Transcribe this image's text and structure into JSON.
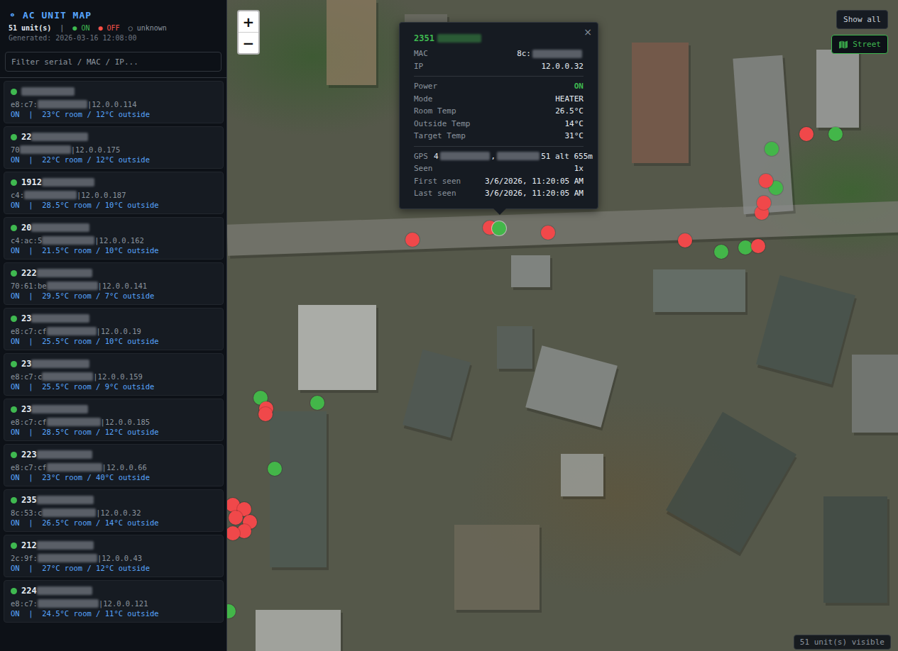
{
  "header": {
    "icon": "⚬",
    "title": "AC UNIT MAP",
    "count": "51 unit(s)",
    "separator": "|",
    "legend": [
      {
        "glyph": "●",
        "label": "ON",
        "color": "#3fb950"
      },
      {
        "glyph": "●",
        "label": "OFF",
        "color": "#f85149"
      },
      {
        "glyph": "○",
        "label": "unknown",
        "color": "#8b949e"
      }
    ],
    "generated": "Generated: 2026-03-16 12:08:00"
  },
  "search": {
    "placeholder": "Filter serial / MAC / IP..."
  },
  "units": [
    {
      "serial": "",
      "mac": "e8:c7:",
      "ip": "12.0.0.114",
      "summary": "ON  |  23°C room / 12°C outside",
      "on": true,
      "color": "#3fb950"
    },
    {
      "serial": "22",
      "mac": "70",
      "ip": "12.0.0.175",
      "summary": "ON  |  22°C room / 12°C outside",
      "on": true,
      "color": "#3fb950"
    },
    {
      "serial": "1912",
      "mac": "c4:",
      "ip": "12.0.0.187",
      "summary": "ON  |  28.5°C room / 10°C outside",
      "on": true,
      "color": "#3fb950"
    },
    {
      "serial": "20",
      "mac": "c4:ac:5",
      "ip": "12.0.0.162",
      "summary": "ON  |  21.5°C room / 10°C outside",
      "on": true,
      "color": "#3fb950"
    },
    {
      "serial": "222",
      "mac": "70:61:be",
      "ip": "12.0.0.141",
      "summary": "ON  |  29.5°C room / 7°C outside",
      "on": true,
      "color": "#3fb950"
    },
    {
      "serial": "23",
      "mac": "e8:c7:cf",
      "ip": "12.0.0.19",
      "summary": "ON  |  25.5°C room / 10°C outside",
      "on": true,
      "color": "#3fb950"
    },
    {
      "serial": "23",
      "mac": "e8:c7:c",
      "ip": "12.0.0.159",
      "summary": "ON  |  25.5°C room / 9°C outside",
      "on": true,
      "color": "#3fb950"
    },
    {
      "serial": "23",
      "mac": "e8:c7:cf",
      "ip": "12.0.0.185",
      "summary": "ON  |  28.5°C room / 12°C outside",
      "on": true,
      "color": "#3fb950"
    },
    {
      "serial": "223",
      "mac": "e8:c7:cf",
      "ip": "12.0.0.66",
      "summary": "ON  |  23°C room / 40°C outside",
      "on": true,
      "color": "#3fb950"
    },
    {
      "serial": "235",
      "mac": "8c:53:c",
      "ip": "12.0.0.32",
      "summary": "ON  |  26.5°C room / 14°C outside",
      "on": true,
      "color": "#3fb950"
    },
    {
      "serial": "212",
      "mac": "2c:9f:",
      "ip": "12.0.0.43",
      "summary": "ON  |  27°C room / 12°C outside",
      "on": true,
      "color": "#3fb950"
    },
    {
      "serial": "224",
      "mac": "e8:c7:",
      "ip": "12.0.0.121",
      "summary": "ON  |  24.5°C room / 11°C outside",
      "on": true,
      "color": "#3fb950"
    }
  ],
  "map": {
    "zoom_in": "+",
    "zoom_out": "−",
    "show_all": "Show all",
    "layer": "Street",
    "visible_count": "51 unit(s) visible",
    "pins": [
      {
        "on": false,
        "color": "#f0484a",
        "selected": false
      },
      {
        "on": false,
        "color": "#f0484a",
        "selected": false
      },
      {
        "on": true,
        "color": "#43b649",
        "selected": true
      },
      {
        "on": false,
        "color": "#f0484a",
        "selected": false
      },
      {
        "on": false,
        "color": "#f0484a",
        "selected": false
      },
      {
        "on": true,
        "color": "#43b649",
        "selected": false
      },
      {
        "on": true,
        "color": "#43b649",
        "selected": false
      },
      {
        "on": false,
        "color": "#f0484a",
        "selected": false
      },
      {
        "on": false,
        "color": "#f0484a",
        "selected": false
      },
      {
        "on": false,
        "color": "#f0484a",
        "selected": false
      },
      {
        "on": true,
        "color": "#43b649",
        "selected": false
      },
      {
        "on": false,
        "color": "#f0484a",
        "selected": false
      },
      {
        "on": true,
        "color": "#43b649",
        "selected": false
      },
      {
        "on": false,
        "color": "#f0484a",
        "selected": false
      },
      {
        "on": true,
        "color": "#43b649",
        "selected": false
      },
      {
        "on": true,
        "color": "#43b649",
        "selected": false
      },
      {
        "on": false,
        "color": "#f0484a",
        "selected": false
      },
      {
        "on": false,
        "color": "#f0484a",
        "selected": false
      },
      {
        "on": true,
        "color": "#43b649",
        "selected": false
      },
      {
        "on": true,
        "color": "#43b649",
        "selected": false
      },
      {
        "on": false,
        "color": "#f0484a",
        "selected": false
      },
      {
        "on": false,
        "color": "#f0484a",
        "selected": false
      },
      {
        "on": false,
        "color": "#f0484a",
        "selected": false
      },
      {
        "on": false,
        "color": "#f0484a",
        "selected": false
      },
      {
        "on": false,
        "color": "#f0484a",
        "selected": false
      },
      {
        "on": false,
        "color": "#f0484a",
        "selected": false
      },
      {
        "on": true,
        "color": "#43b649",
        "selected": false
      }
    ]
  },
  "popup": {
    "title": "2351",
    "close": "×",
    "sections": [
      [
        {
          "label": "MAC",
          "highlight": false,
          "segments": [
            {
              "kind": "text",
              "text": "8c:"
            },
            {
              "kind": "redacted"
            }
          ]
        },
        {
          "label": "IP",
          "highlight": false,
          "segments": [
            {
              "kind": "text",
              "text": "12.0.0.32"
            }
          ]
        }
      ],
      [
        {
          "label": "Power",
          "highlight": true,
          "segments": [
            {
              "kind": "text",
              "text": "ON"
            }
          ]
        },
        {
          "label": "Mode",
          "highlight": false,
          "segments": [
            {
              "kind": "text",
              "text": "HEATER"
            }
          ]
        },
        {
          "label": "Room Temp",
          "highlight": false,
          "segments": [
            {
              "kind": "text",
              "text": "26.5°C"
            }
          ]
        },
        {
          "label": "Outside Temp",
          "highlight": false,
          "segments": [
            {
              "kind": "text",
              "text": "14°C"
            }
          ]
        },
        {
          "label": "Target Temp",
          "highlight": false,
          "segments": [
            {
              "kind": "text",
              "text": "31°C"
            }
          ]
        }
      ],
      [
        {
          "label": "GPS",
          "highlight": false,
          "segments": [
            {
              "kind": "text",
              "text": "4"
            },
            {
              "kind": "redacted"
            },
            {
              "kind": "text",
              "text": ","
            },
            {
              "kind": "redacted"
            },
            {
              "kind": "text",
              "text": "51 alt 655m"
            }
          ]
        },
        {
          "label": "Seen",
          "highlight": false,
          "segments": [
            {
              "kind": "text",
              "text": "1x"
            }
          ]
        },
        {
          "label": "First seen",
          "highlight": false,
          "segments": [
            {
              "kind": "text",
              "text": "3/6/2026, 11:20:05 AM"
            }
          ]
        },
        {
          "label": "Last seen",
          "highlight": false,
          "segments": [
            {
              "kind": "text",
              "text": "3/6/2026, 11:20:05 AM"
            }
          ]
        }
      ]
    ]
  }
}
